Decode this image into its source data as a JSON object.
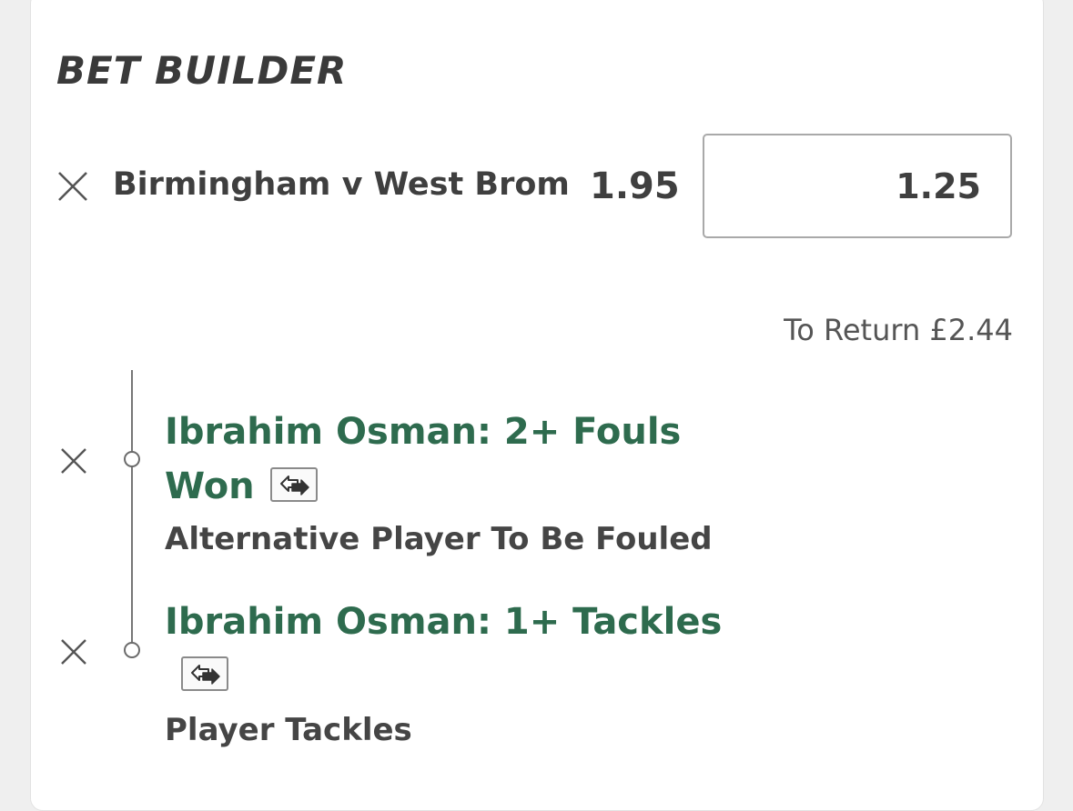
{
  "header": {
    "title": "BET BUILDER"
  },
  "bet": {
    "event": "Birmingham v West Brom",
    "odds": "1.95",
    "stake": "1.25",
    "to_return": "To Return £2.44"
  },
  "legs": [
    {
      "selection_line1": "Ibrahim Osman: 2+ Fouls",
      "selection_line2": "Won",
      "market": "Alternative Player To Be Fouled",
      "icon": "swap-icon"
    },
    {
      "selection_line1": "Ibrahim Osman: 1+ Tackles",
      "market": "Player Tackles",
      "icon": "swap-icon"
    }
  ],
  "colors": {
    "selection_green": "#2e6b4e",
    "text_dark": "#3f3f3f",
    "background": "#efefef"
  },
  "icons": {
    "remove": "close-icon",
    "swap": "swap-icon"
  }
}
